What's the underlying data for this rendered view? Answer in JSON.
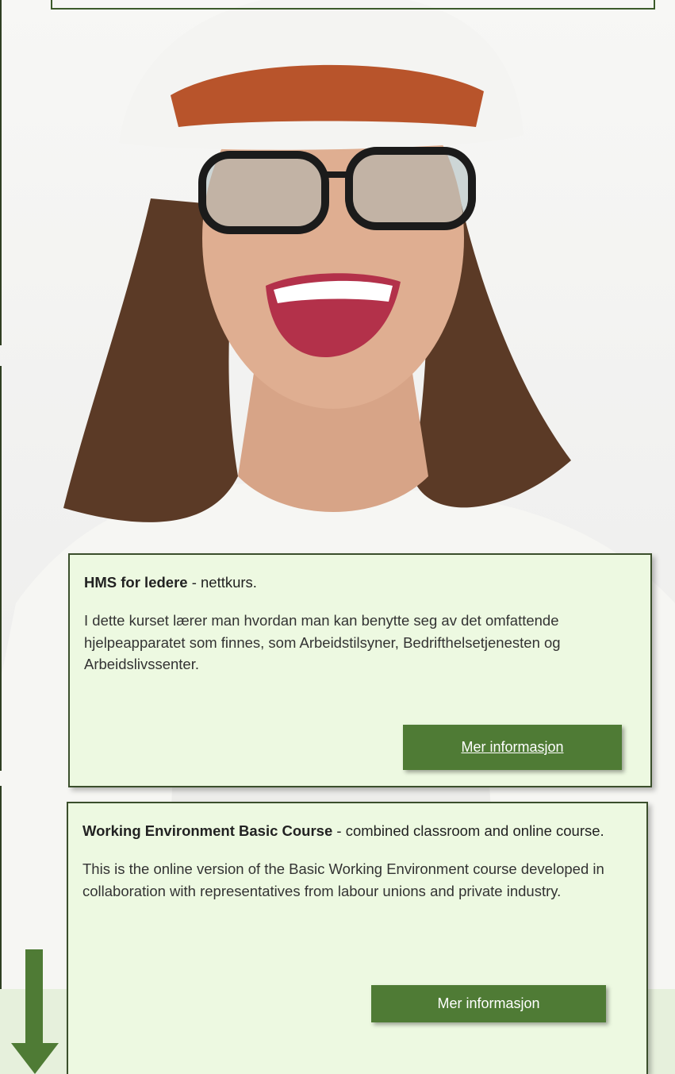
{
  "cards": [
    {
      "title_bold": "HMS for ledere",
      "title_rest": " - nettkurs.",
      "body": "I dette kurset lærer man hvordan man kan benytte seg av det omfattende hjelpeapparatet som finnes, som Arbeidstilsyner, Bedrifthelsetjenesten og Arbeidslivssenter.",
      "button_label": "Mer informasjon"
    },
    {
      "title_bold": "Working Environment Basic Course",
      "title_rest": " - combined classroom and online course.",
      "body": "This is the online version of the Basic Working Environment course developed in collaboration with representatives from labour unions and private industry.",
      "button_label": "Mer informasjon"
    }
  ],
  "colors": {
    "card_bg": "#edf9e1",
    "card_border": "#3b4f2c",
    "button_bg": "#4f7b35",
    "arrow": "#4f7b35"
  },
  "icons": {
    "scroll_arrow": "arrow-down-icon"
  }
}
